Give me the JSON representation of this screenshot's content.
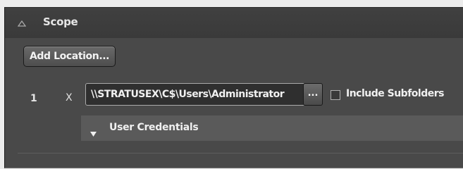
{
  "scope": {
    "title": "Scope",
    "toggle_icon": "collapse-triangle-icon",
    "add_location_label": "Add Location...",
    "locations": [
      {
        "index": "1",
        "remove_label": "X",
        "path": "\\\\STRATUSEX\\C$\\Users\\Administrator",
        "browse_label": "...",
        "include_subfolders_label": "Include Subfolders",
        "include_subfolders_checked": false,
        "credentials": {
          "label": "User Credentials",
          "expand_icon": "expand-triangle-icon"
        }
      }
    ]
  },
  "colors": {
    "panel_bg": "#494949",
    "header_bg": "#3c3c3c",
    "credentials_bg": "#5a5a5a",
    "text": "#f0f0f0"
  }
}
